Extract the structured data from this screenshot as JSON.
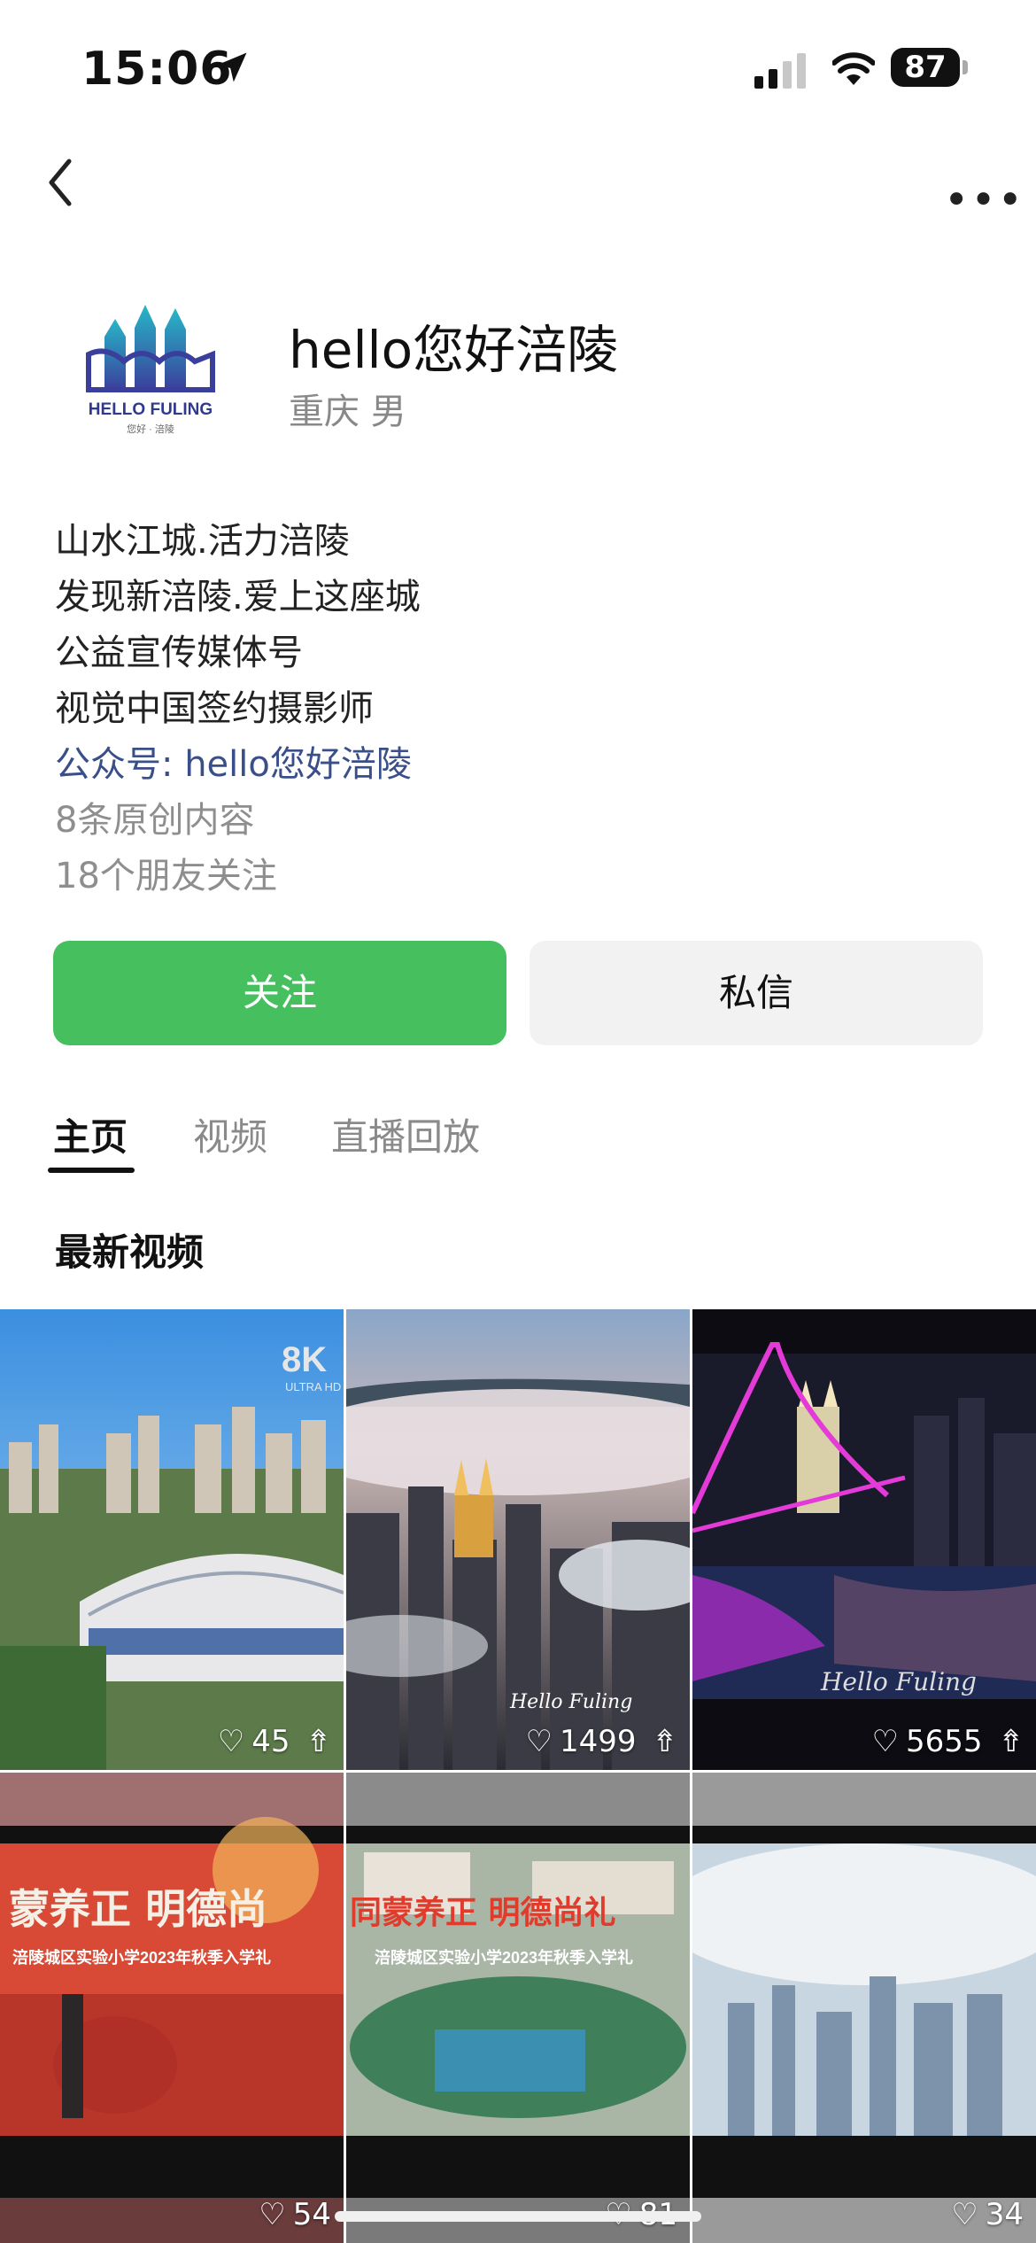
{
  "status_bar": {
    "time": "15:06",
    "battery": "87"
  },
  "profile": {
    "name": "hello您好涪陵",
    "meta": "重庆 男",
    "logo_text": "HELLO FULING",
    "logo_subtext": "您好 · 涪陵"
  },
  "bio": {
    "line1": "山水江城.活力涪陵",
    "line2": "发现新涪陵.爱上这座城",
    "line3": "公益宣传媒体号",
    "line4": "视觉中国签约摄影师",
    "official_account": "公众号: hello您好涪陵",
    "original_count": "8条原创内容",
    "friends_following": "18个朋友关注"
  },
  "actions": {
    "follow": "关注",
    "message": "私信"
  },
  "tabs": {
    "home": "主页",
    "video": "视频",
    "replay": "直播回放"
  },
  "section": {
    "title": "最新视频"
  },
  "videos": [
    {
      "likes": "45",
      "overlay": "8K",
      "overlay_sub": "ULTRA HD",
      "caption": ""
    },
    {
      "likes": "1499",
      "overlay": "",
      "overlay_sub": "",
      "caption": "Hello Fuling"
    },
    {
      "likes": "5655",
      "overlay": "",
      "overlay_sub": "",
      "caption": "Hello Fuling"
    },
    {
      "likes": "54",
      "overlay": "蒙养正  明德尚",
      "overlay_sub": "涪陵城区实验小学2023年秋季入学礼",
      "caption": ""
    },
    {
      "likes": "81",
      "overlay": "同蒙养正  明德尚礼",
      "overlay_sub": "涪陵城区实验小学2023年秋季入学礼",
      "caption": ""
    },
    {
      "likes": "34",
      "overlay": "",
      "overlay_sub": "",
      "caption": ""
    }
  ],
  "colors": {
    "follow_button": "#46c05f",
    "link": "#3a4f8a",
    "secondary_text": "#8e8e8e"
  }
}
